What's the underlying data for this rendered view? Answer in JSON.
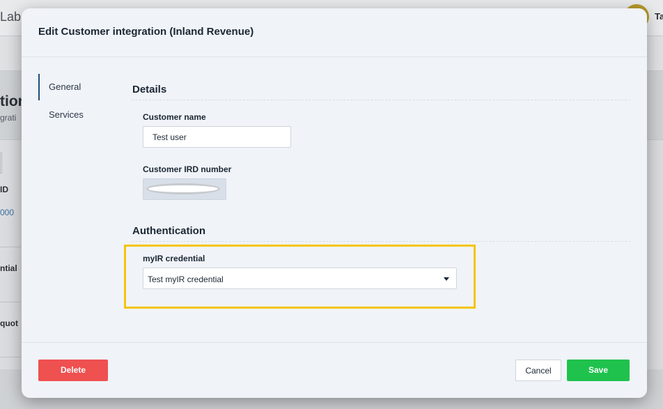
{
  "background": {
    "logo_fragment": "Lab",
    "user_fragment": "Ta",
    "title_fragment": "tion",
    "subtitle_fragment": "grati",
    "column_fragment": "ID",
    "value_fragment": "000",
    "section1_fragment": "ntial",
    "section2_fragment": "quot"
  },
  "modal": {
    "title": "Edit Customer integration (Inland Revenue)",
    "nav": [
      {
        "label": "General",
        "active": true
      },
      {
        "label": "Services",
        "active": false
      }
    ],
    "details": {
      "heading": "Details",
      "customer_name_label": "Customer name",
      "customer_name_value": "Test user",
      "customer_ird_label": "Customer IRD number"
    },
    "authentication": {
      "heading": "Authentication",
      "credential_label": "myIR credential",
      "credential_value": "Test myIR credential"
    },
    "footer": {
      "delete_label": "Delete",
      "cancel_label": "Cancel",
      "save_label": "Save"
    }
  },
  "colors": {
    "highlight": "#f5c40e",
    "delete": "#ef5050",
    "save": "#1fc24d",
    "nav_active": "#1f4e79"
  },
  "icons": {
    "dropdown": "chevron-down-icon"
  }
}
